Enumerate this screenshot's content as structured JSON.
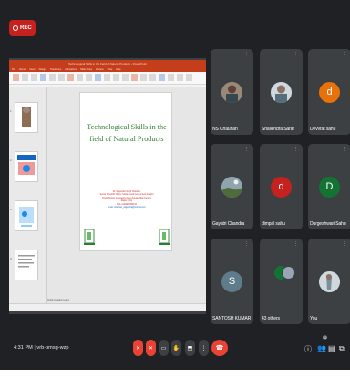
{
  "recording": {
    "label": "REC"
  },
  "presentation": {
    "window_title": "Technological Skills in the Field of Natural Products - PowerPoint",
    "tabs": [
      "File",
      "Home",
      "Insert",
      "Design",
      "Transitions",
      "Animations",
      "Slide Show",
      "Review",
      "View",
      "Help"
    ],
    "slide_numbers": [
      "1",
      "2",
      "3",
      "4"
    ],
    "slide": {
      "title": "Technological Skills in the field of Natural Products",
      "credit_lines": [
        "Dr. Nagendra Singh Chauhan",
        "Senior Scientific Officer Grade-II and Government Analyst",
        "Drugs Testing Laboratory Avam Anusandhan Kendra",
        "Raipur (CG)",
        "Mob.+919406356134"
      ],
      "email": "email- chauhan_nagendra@hotmail.com"
    },
    "notes_label": "Click to add notes"
  },
  "participants": [
    {
      "name": "NS Chauhan",
      "kind": "photo",
      "color": "#9a8878"
    },
    {
      "name": "Shailendra Saraf",
      "kind": "photo",
      "color": "#8a8f98"
    },
    {
      "name": "Devvrat sahu",
      "initial": "d",
      "color": "#e8710a"
    },
    {
      "name": "Gayatri Chandra",
      "kind": "photo",
      "color": "#6b8fb3"
    },
    {
      "name": "dimpal sahu",
      "initial": "d",
      "color": "#c5221f"
    },
    {
      "name": "Durgeshwari Sahu",
      "initial": "D",
      "color": "#137333"
    },
    {
      "name": "SANTOSH KUMAR",
      "initial": "S",
      "color": "#5f7c8a"
    },
    {
      "name": "43 others",
      "kind": "group",
      "color": "#3c4043"
    },
    {
      "name": "You",
      "kind": "photo",
      "color": "#9aa6b5"
    }
  ],
  "meeting": {
    "time": "4:31 PM",
    "code": "vrb-bmsg-wzp",
    "participant_count": "52"
  },
  "icons": {
    "mic": "mic-off-icon",
    "camera": "camera-off-icon",
    "captions": "captions-icon",
    "hand": "raise-hand-icon",
    "present": "present-icon",
    "more": "more-options-icon",
    "hangup": "call-end-icon",
    "info": "info-icon",
    "people": "people-icon",
    "chat": "chat-icon",
    "activities": "activities-icon"
  },
  "colors": {
    "background": "#202124",
    "tile": "#3c4043",
    "danger": "#ea4335",
    "slide_title": "#2e7d32"
  }
}
